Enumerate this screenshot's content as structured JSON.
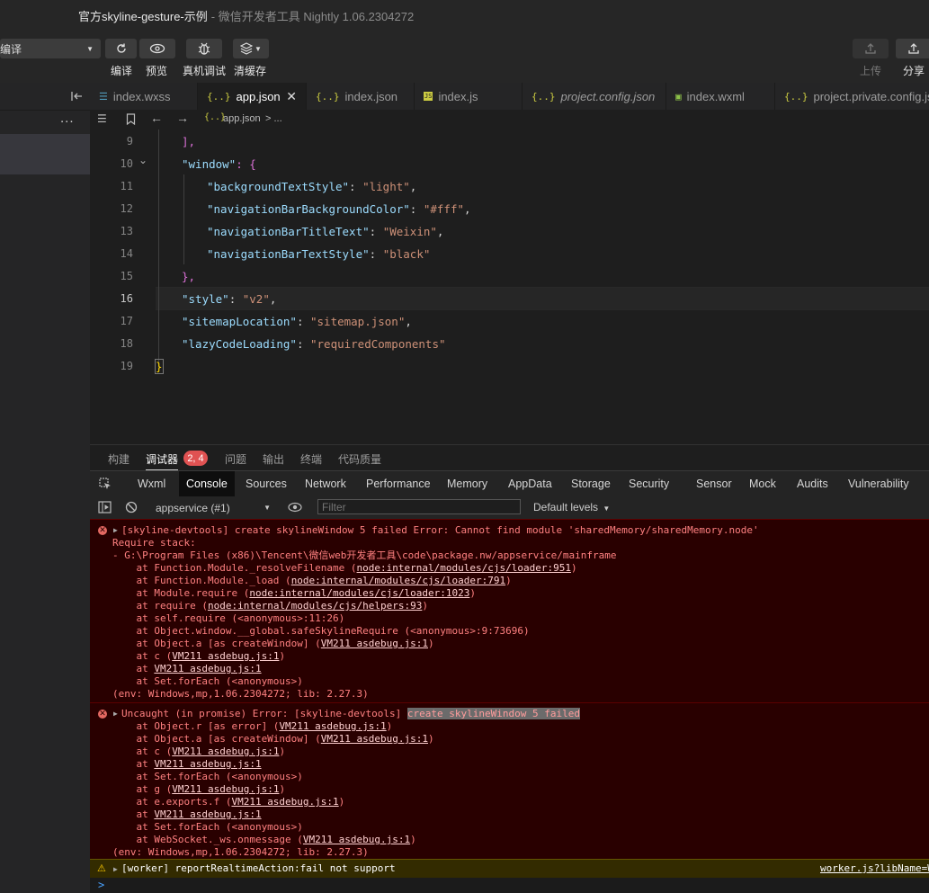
{
  "window": {
    "title": "官方skyline-gesture-示例",
    "subtitle": "- 微信开发者工具 Nightly 1.06.2304272"
  },
  "toolbar": {
    "compile_mode": "编译",
    "compile_label": "编译",
    "preview_label": "预览",
    "device_debug_label": "真机调试",
    "clear_cache_label": "清缓存",
    "upload_label": "上传",
    "share_label": "分享"
  },
  "sidebar": {
    "more": "..."
  },
  "tabs": [
    {
      "label": "index.wxss",
      "icon": "css-icon"
    },
    {
      "label": "app.json",
      "icon": "json-icon",
      "active": true
    },
    {
      "label": "index.json",
      "icon": "json-icon"
    },
    {
      "label": "index.js",
      "icon": "js-icon"
    },
    {
      "label": "project.config.json",
      "icon": "json-icon"
    },
    {
      "label": "index.wxml",
      "icon": "wxml-icon"
    },
    {
      "label": "project.private.config.js",
      "icon": "json-icon"
    }
  ],
  "breadcrumb": {
    "file": "app.json",
    "sep": "> ..."
  },
  "editor": {
    "current_line": 16,
    "lines": [
      {
        "n": "9",
        "text": "],"
      },
      {
        "n": "10",
        "key": "\"window\"",
        "rest": ": {"
      },
      {
        "n": "11",
        "key": "\"backgroundTextStyle\"",
        "val": "\"light\"",
        "tail": ","
      },
      {
        "n": "12",
        "key": "\"navigationBarBackgroundColor\"",
        "val": "\"#fff\"",
        "tail": ","
      },
      {
        "n": "13",
        "key": "\"navigationBarTitleText\"",
        "val": "\"Weixin\"",
        "tail": ","
      },
      {
        "n": "14",
        "key": "\"navigationBarTextStyle\"",
        "val": "\"black\"",
        "tail": ""
      },
      {
        "n": "15",
        "text": "},"
      },
      {
        "n": "16",
        "key": "\"style\"",
        "val": "\"v2\"",
        "tail": ","
      },
      {
        "n": "17",
        "key": "\"sitemapLocation\"",
        "val": "\"sitemap.json\"",
        "tail": ","
      },
      {
        "n": "18",
        "key": "\"lazyCodeLoading\"",
        "val": "\"requiredComponents\"",
        "tail": ""
      },
      {
        "n": "19",
        "text": "}"
      }
    ]
  },
  "panel_tabs": {
    "build": "构建",
    "debugger": "调试器",
    "badge": "2, 4",
    "issues": "问题",
    "output": "输出",
    "terminal": "终端",
    "quality": "代码质量"
  },
  "devtools_tabs": [
    "Wxml",
    "Console",
    "Sources",
    "Network",
    "Performance",
    "Memory",
    "AppData",
    "Storage",
    "Security",
    "Sensor",
    "Mock",
    "Audits",
    "Vulnerability"
  ],
  "filter": {
    "context": "appservice (#1)",
    "placeholder": "Filter",
    "levels": "Default levels"
  },
  "console": {
    "error1": {
      "head": "[skyline-devtools] create skylineWindow 5 failed Error: Cannot find module 'sharedMemory/sharedMemory.node'",
      "l1": "Require stack:",
      "l2": "- G:\\Program Files (x86)\\Tencent\\微信web开发者工具\\code\\package.nw/appservice/mainframe",
      "frames": [
        {
          "pre": "    at Function.Module._resolveFilename (",
          "link": "node:internal/modules/cjs/loader:951",
          "post": ")"
        },
        {
          "pre": "    at Function.Module._load (",
          "link": "node:internal/modules/cjs/loader:791",
          "post": ")"
        },
        {
          "pre": "    at Module.require (",
          "link": "node:internal/modules/cjs/loader:1023",
          "post": ")"
        },
        {
          "pre": "    at require (",
          "link": "node:internal/modules/cjs/helpers:93",
          "post": ")"
        },
        {
          "pre": "    at self.require (<anonymous>:11:26)",
          "link": "",
          "post": ""
        },
        {
          "pre": "    at Object.window.__global.safeSkylineRequire (<anonymous>:9:73696)",
          "link": "",
          "post": ""
        },
        {
          "pre": "    at Object.a [as createWindow] (",
          "link": "VM211 asdebug.js:1",
          "post": ")"
        },
        {
          "pre": "    at c (",
          "link": "VM211 asdebug.js:1",
          "post": ")"
        },
        {
          "pre": "    at ",
          "link": "VM211 asdebug.js:1",
          "post": ""
        },
        {
          "pre": "    at Set.forEach (<anonymous>)",
          "link": "",
          "post": ""
        }
      ],
      "env": "(env: Windows,mp,1.06.2304272; lib: 2.27.3)"
    },
    "error2": {
      "head": "Uncaught (in promise) Error: [skyline-devtools] ",
      "highlight": "create skylineWindow 5 failed",
      "frames": [
        {
          "pre": "    at Object.r [as error] (",
          "link": "VM211 asdebug.js:1",
          "post": ")"
        },
        {
          "pre": "    at Object.a [as createWindow] (",
          "link": "VM211 asdebug.js:1",
          "post": ")"
        },
        {
          "pre": "    at c (",
          "link": "VM211 asdebug.js:1",
          "post": ")"
        },
        {
          "pre": "    at ",
          "link": "VM211 asdebug.js:1",
          "post": ""
        },
        {
          "pre": "    at Set.forEach (<anonymous>)",
          "link": "",
          "post": ""
        },
        {
          "pre": "    at g (",
          "link": "VM211 asdebug.js:1",
          "post": ")"
        },
        {
          "pre": "    at e.exports.f (",
          "link": "VM211 asdebug.js:1",
          "post": ")"
        },
        {
          "pre": "    at ",
          "link": "VM211 asdebug.js:1",
          "post": ""
        },
        {
          "pre": "    at Set.forEach (<anonymous>)",
          "link": "",
          "post": ""
        },
        {
          "pre": "    at WebSocket._ws.onmessage (",
          "link": "VM211 asdebug.js:1",
          "post": ")"
        }
      ],
      "env": "(env: Windows,mp,1.06.2304272; lib: 2.27.3)"
    },
    "warning": {
      "text": "[worker] reportRealtimeAction:fail not support",
      "link": "worker.js?libName=W"
    },
    "prompt": ">"
  },
  "colors": {
    "error_bg": "#290000",
    "error_text": "#ff8080",
    "warning_bg": "#332b00",
    "badge": "#e05252"
  }
}
